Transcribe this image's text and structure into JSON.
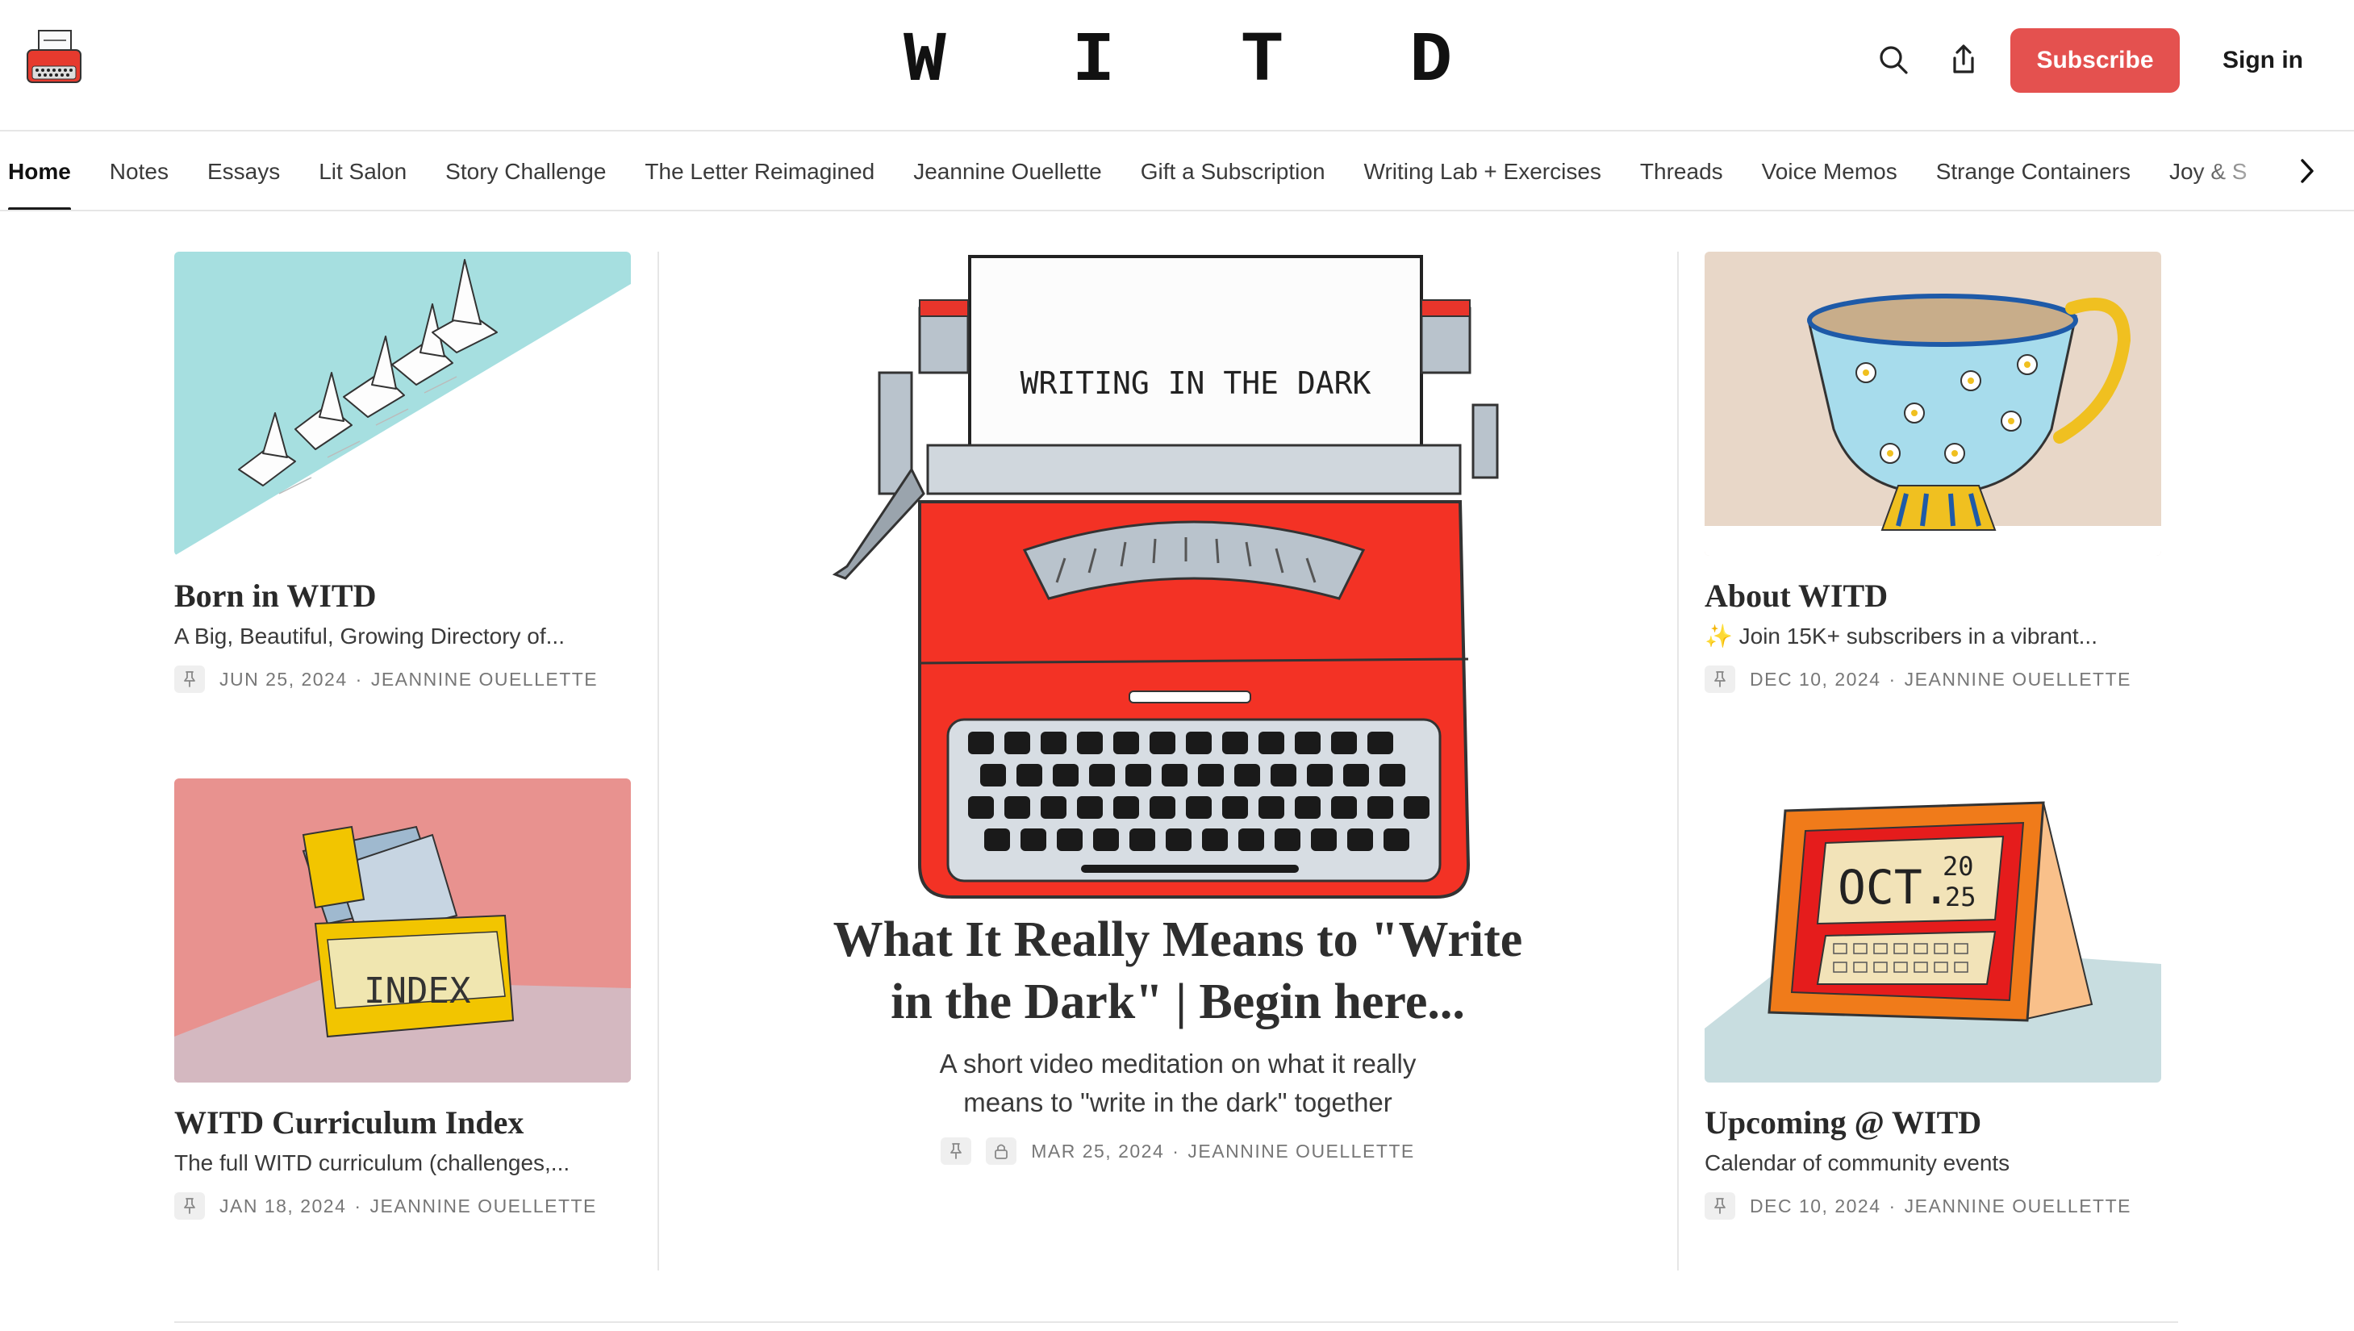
{
  "header": {
    "wordmark_letters": [
      "W",
      "I",
      "T",
      "D"
    ],
    "subscribe_label": "Subscribe",
    "signin_label": "Sign in",
    "accent_color": "#e4514f",
    "icons": [
      "typewriter-logo-icon",
      "search-icon",
      "share-icon"
    ]
  },
  "nav": {
    "items": [
      {
        "label": "Home",
        "active": true
      },
      {
        "label": "Notes"
      },
      {
        "label": "Essays"
      },
      {
        "label": "Lit Salon"
      },
      {
        "label": "Story Challenge"
      },
      {
        "label": "The Letter Reimagined"
      },
      {
        "label": "Jeannine Ouellette"
      },
      {
        "label": "Gift a Subscription"
      },
      {
        "label": "Writing Lab + Exercises"
      },
      {
        "label": "Threads"
      },
      {
        "label": "Voice Memos"
      },
      {
        "label": "Strange Containers"
      },
      {
        "label": "Joy & S"
      }
    ],
    "scroll_icon": "chevron-right-icon"
  },
  "feature": {
    "image_text": "WRITING IN THE DARK",
    "title_line1": "What It Really Means to \"Write",
    "title_line2": "in the Dark\" | Begin here...",
    "subtitle_line1": "A short video meditation on what it really",
    "subtitle_line2": "means to \"write in the dark\" together",
    "date": "MAR 25, 2024",
    "author": "JEANNINE OUELLETTE"
  },
  "cards": [
    {
      "title": "Born in WITD",
      "subtitle": "A Big, Beautiful, Growing Directory of...",
      "date": "JUN 25, 2024",
      "author": "JEANNINE OUELLETTE"
    },
    {
      "title": "WITD Curriculum Index",
      "subtitle": "The full WITD curriculum (challenges,...",
      "date": "JAN 18, 2024",
      "author": "JEANNINE OUELLETTE",
      "image_text": "INDEX"
    },
    {
      "title": "About WITD",
      "subtitle": "✨ Join 15K+ subscribers in a vibrant...",
      "date": "DEC 10, 2024",
      "author": "JEANNINE OUELLETTE"
    },
    {
      "title": "Upcoming @ WITD",
      "subtitle": "Calendar of community events",
      "date": "DEC 10, 2024",
      "author": "JEANNINE OUELLETTE",
      "image_text_month": "OCT.",
      "image_text_year_top": "20",
      "image_text_year_bottom": "25"
    }
  ],
  "meta_separator": "·"
}
